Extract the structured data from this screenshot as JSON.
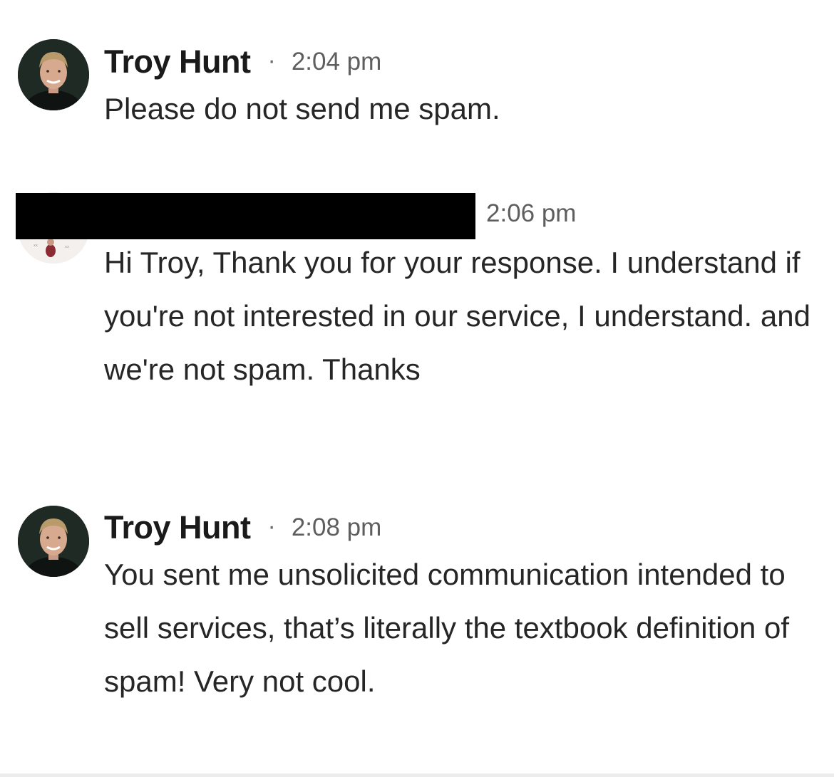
{
  "messages": [
    {
      "sender": "Troy Hunt",
      "separator": "·",
      "time": "2:04 pm",
      "text": "Please do not send me spam."
    },
    {
      "sender": "",
      "time": "2:06 pm",
      "text": "Hi Troy, Thank you for your response. I understand if you're not interested in our service, I understand. and we're not spam. Thanks"
    },
    {
      "sender": "Troy Hunt",
      "separator": "·",
      "time": "2:08 pm",
      "text": "You sent me unsolicited communication intended to sell services, that’s literally the textbook definition of spam! Very not cool."
    }
  ],
  "colors": {
    "background": "#ffffff",
    "text": "#262626",
    "timestamp": "#5e5e5e",
    "redaction": "#000000"
  }
}
